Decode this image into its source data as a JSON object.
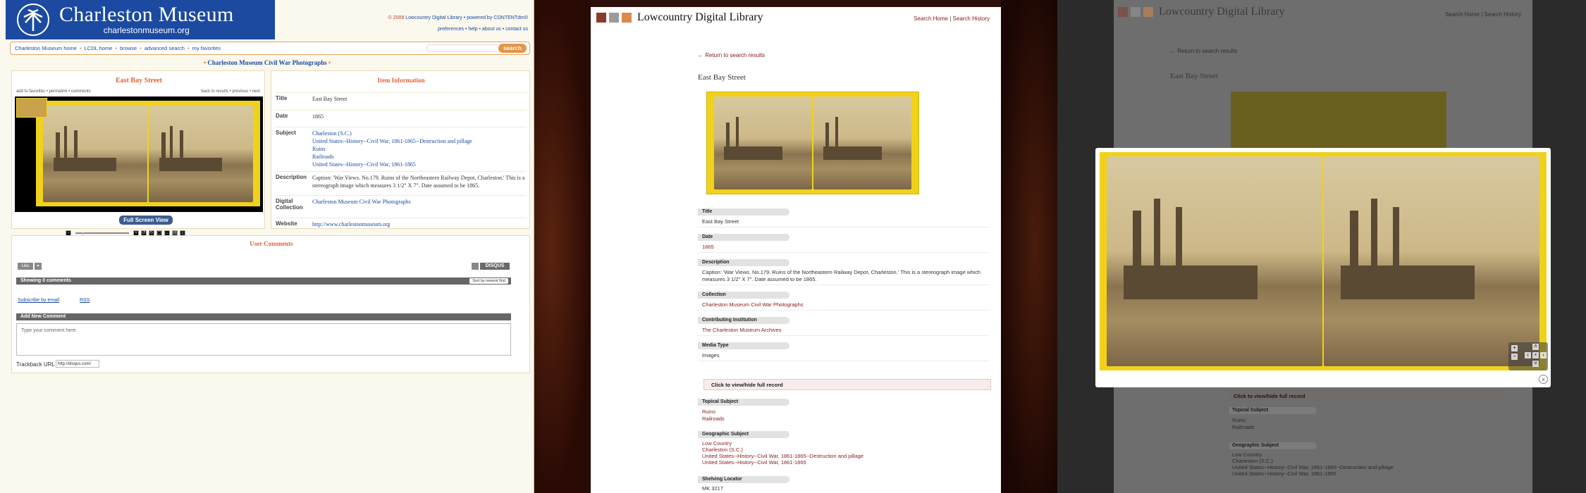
{
  "charleston": {
    "logo": {
      "name": "Charleston Museum",
      "url": "charlestonmuseum.org"
    },
    "header_links": {
      "copyright": "© 2009",
      "credit": "Lowcountry Digital Library • powered by CONTENTdm®",
      "links": "preferences • help • about us • contact us"
    },
    "nav": {
      "items": [
        "Charleston Museum home",
        "LCDL home",
        "browse",
        "advanced search",
        "my favorites"
      ],
      "search_button": "search",
      "search_placeholder": ""
    },
    "collection_title": "Charleston Museum Civil War Photographs",
    "item": {
      "title": "East Bay Street",
      "subnav_left": "add to favorites • permalink • comments",
      "subnav_right": "back to results • previous • next",
      "fullscreen": "Full Screen View"
    },
    "info": {
      "heading": "Item Information",
      "fields": [
        {
          "label": "Title",
          "value": "East Bay Street"
        },
        {
          "label": "Date",
          "value": "1865"
        },
        {
          "label": "Subject",
          "lines": [
            "Charleston (S.C.)",
            "United States--History--Civil War, 1861-1865--Destruction and pillage",
            "Ruins",
            "Railroads",
            "United States--History--Civil War, 1861-1865"
          ]
        },
        {
          "label": "Description",
          "value": "Caption: 'War Views. No.179. Ruins of the Northeastern Railway Depot, Charleston.' This is a stereograph image which measures 3 1/2\" X 7\". Date assumed to be 1865."
        },
        {
          "label": "Digital Collection",
          "value": "Charleston Museum Civil War Photographs"
        },
        {
          "label": "Website",
          "value": "http://www.charlestonmuseum.org"
        }
      ]
    },
    "comments": {
      "heading": "User Comments",
      "like": "Like",
      "disqus": "DISQUS",
      "showing": "Showing 0 comments",
      "sort": "Sort by newest first",
      "subscribe": "Subscribe by email",
      "rss": "RSS",
      "add_new": "Add New Comment",
      "textarea_placeholder": "Type your comment here.",
      "trackback_label": "Trackback URL",
      "trackback_value": "http://disqus.com/"
    }
  },
  "lcdl": {
    "site_name": "Lowcountry Digital Library",
    "links": {
      "search_home": "Search Home",
      "divider": " | ",
      "search_history": "Search History"
    },
    "back": "Return to search results",
    "title": "East Bay Street",
    "fields": [
      {
        "label": "Title",
        "value": "East Bay Street"
      },
      {
        "label": "Date",
        "value": "1865"
      },
      {
        "label": "Description",
        "value": "Caption: 'War Views. No.179. Ruins of the Northeastern Railway Depot, Charleston.' This is a stereograph image which measures 3 1/2\" X 7\". Date assumed to be 1865."
      },
      {
        "label": "Collection",
        "value": "Charleston Museum Civil War Photographs"
      },
      {
        "label": "Contributing Institution",
        "value": "The Charleston Museum Archives"
      },
      {
        "label": "Media Type",
        "value": "Images"
      }
    ],
    "toggle": "Click to view/hide full record",
    "topical": {
      "label": "Topical Subject",
      "lines": [
        "Ruins",
        "Railroads"
      ]
    },
    "geographic": {
      "label": "Geographic Subject",
      "lines": [
        "Low Country",
        "Charleston (S.C.)",
        "United States--History--Civil War, 1861-1865--Destruction and pillage",
        "United States--History--Civil War, 1861-1865"
      ]
    },
    "shelving": {
      "label": "Shelving Locator",
      "value": "MK 3217"
    }
  },
  "colors": {
    "charleston_blue": "#1b4aa0",
    "accent_orange": "#e0623a",
    "stereograph_yellow": "#f0d21a",
    "lcdl_link_red": "#8a1b1b"
  },
  "icons": [
    "palmetto-emblem-icon",
    "zoom-in-icon",
    "zoom-out-icon",
    "pan-arrow-icon",
    "close-icon",
    "rss-icon",
    "email-icon"
  ]
}
